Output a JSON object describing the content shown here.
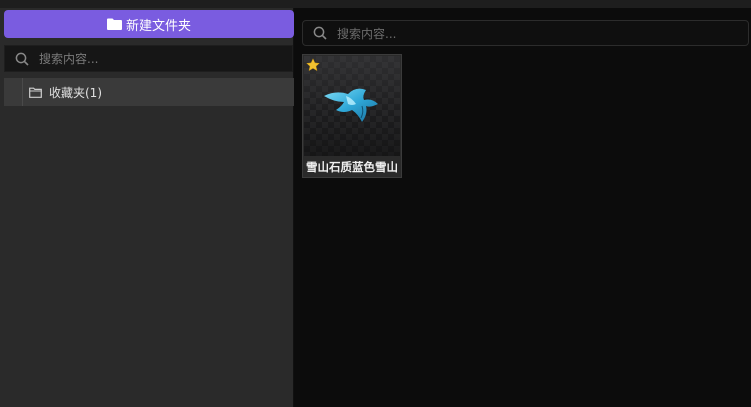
{
  "sidebar": {
    "new_folder_label": "新建文件夹",
    "search_placeholder": "搜索内容...",
    "tree": [
      {
        "label": "收藏夹(1)"
      }
    ]
  },
  "main": {
    "search_placeholder": "搜索内容...",
    "items": [
      {
        "title": "雪山石质蓝色雪山",
        "favorite": true,
        "icon": "blue-model-icon"
      }
    ]
  },
  "colors": {
    "accent": "#7a5ce0",
    "star": "#f2c230",
    "model": "#3fb4e0"
  }
}
